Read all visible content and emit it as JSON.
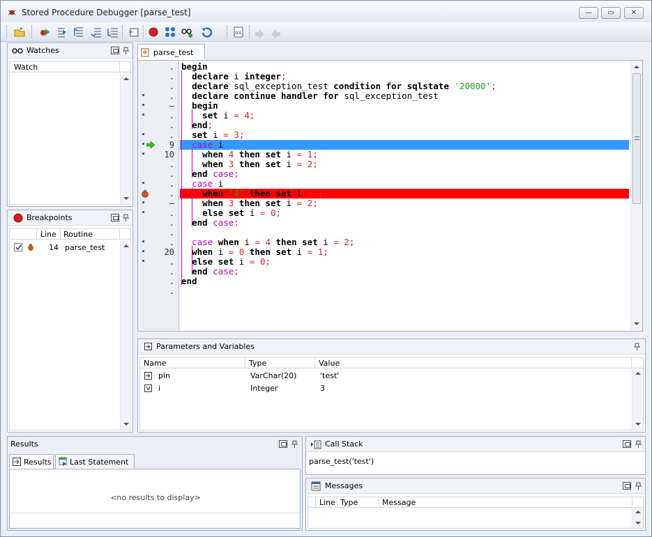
{
  "window": {
    "title": "Stored Procedure Debugger [parse_test]",
    "minimize_glyph": "—",
    "maximize_glyph": "▭",
    "close_glyph": "✕"
  },
  "toolbar": {
    "buttons": [
      "open-icon",
      "run-icon",
      "step-into-icon",
      "step-over-icon",
      "step-out-icon",
      "run-to-cursor-icon",
      "restart-icon",
      "toggle-breakpoint-icon",
      "breakpoints-list-icon",
      "watch-icon",
      "undo-icon",
      "sql-icon",
      "forward-icon",
      "back-icon"
    ]
  },
  "watches": {
    "title": "Watches",
    "column": "Watch"
  },
  "breakpoints": {
    "title": "Breakpoints",
    "columns": [
      "Line",
      "Routine"
    ],
    "rows": [
      {
        "checked": true,
        "line": "14",
        "routine": "parse_test"
      }
    ]
  },
  "editor": {
    "tab": "parse_test",
    "gutter": [
      {
        "mark": false,
        "num": "."
      },
      {
        "mark": false,
        "num": "."
      },
      {
        "mark": false,
        "num": "."
      },
      {
        "mark": true,
        "num": "."
      },
      {
        "mark": true,
        "num": "–"
      },
      {
        "mark": true,
        "num": "."
      },
      {
        "mark": false,
        "num": "."
      },
      {
        "mark": true,
        "num": "."
      },
      {
        "mark": true,
        "num": "9"
      },
      {
        "mark": true,
        "num": "10"
      },
      {
        "mark": false,
        "num": "."
      },
      {
        "mark": false,
        "num": "."
      },
      {
        "mark": true,
        "num": "."
      },
      {
        "mark": false,
        "num": "."
      },
      {
        "mark": true,
        "num": "–"
      },
      {
        "mark": true,
        "num": "."
      },
      {
        "mark": false,
        "num": "."
      },
      {
        "mark": false,
        "num": "."
      },
      {
        "mark": true,
        "num": "."
      },
      {
        "mark": true,
        "num": "20"
      },
      {
        "mark": true,
        "num": "."
      },
      {
        "mark": false,
        "num": "."
      },
      {
        "mark": false,
        "num": "."
      },
      {
        "mark": false,
        "num": "."
      }
    ],
    "lines": [
      "begin",
      "  declare i integer;",
      "  declare sql_exception_test condition for sqlstate '20000';",
      "  declare continue handler for sql_exception_test",
      "  begin",
      "    set i = 4;",
      "  end;",
      "  set i = 3;",
      "  case i",
      "    when 4 then set i = 1;",
      "    when 3 then set i = 2;",
      "  end case;",
      "  case i",
      "    when '4' then set i = 1;",
      "    when 3 then set i = 2;",
      "    else set i = 0;",
      "  end case;",
      "",
      "  case when i = 4 then set i = 2;",
      "  when i = 0 then set i = 1;",
      "  else set i = 0;",
      "  end case;",
      "end",
      ""
    ],
    "current_line_index": 8,
    "breakpoint_line_index": 13
  },
  "params": {
    "title": "Parameters and Variables",
    "columns": [
      "Name",
      "Type",
      "Value"
    ],
    "rows": [
      {
        "name": "pin",
        "type": "VarChar(20)",
        "value": "'test'"
      },
      {
        "name": "i",
        "type": "Integer",
        "value": "3"
      }
    ]
  },
  "results": {
    "title": "Results",
    "tabs": [
      "Results",
      "Last Statement"
    ],
    "empty": "<no results to display>"
  },
  "callstack": {
    "title": "Call Stack",
    "entry": "parse_test('test')"
  },
  "messages": {
    "title": "Messages",
    "columns": [
      "Line",
      "Type",
      "Message"
    ]
  },
  "colors": {
    "current_line": "#3399ff",
    "breakpoint_line": "#ff0000",
    "string": "#1e9d1e",
    "number": "#e41f1f",
    "case_keyword": "#c000c0"
  }
}
